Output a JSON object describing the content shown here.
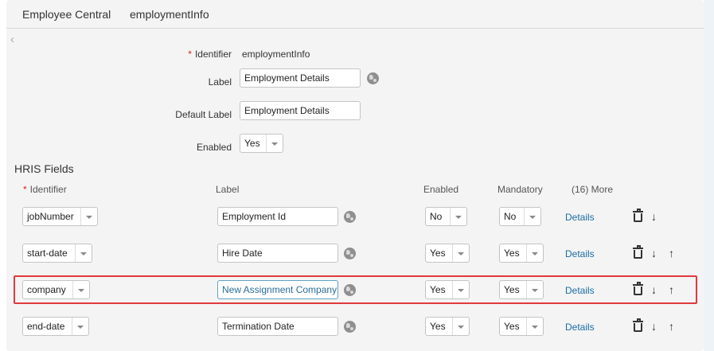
{
  "header": {
    "app": "Employee Central",
    "entity": "employmentInfo"
  },
  "form": {
    "identifier_label": "Identifier",
    "identifier_value": "employmentInfo",
    "label_label": "Label",
    "label_value": "Employment Details",
    "default_label_label": "Default Label",
    "default_label_value": "Employment Details",
    "enabled_label": "Enabled",
    "enabled_value": "Yes"
  },
  "hris": {
    "title": "HRIS Fields",
    "columns": {
      "identifier": "Identifier",
      "label": "Label",
      "enabled": "Enabled",
      "mandatory": "Mandatory",
      "more": "(16) More"
    },
    "rows": [
      {
        "identifier": "jobNumber",
        "label": "Employment Id",
        "enabled": "No",
        "mandatory": "No",
        "details": "Details"
      },
      {
        "identifier": "start-date",
        "label": "Hire Date",
        "enabled": "Yes",
        "mandatory": "Yes",
        "details": "Details"
      },
      {
        "identifier": "company",
        "label": "New Assignment Company",
        "enabled": "Yes",
        "mandatory": "Yes",
        "details": "Details"
      },
      {
        "identifier": "end-date",
        "label": "Termination Date",
        "enabled": "Yes",
        "mandatory": "Yes",
        "details": "Details"
      }
    ]
  },
  "icons": {
    "translate": "globe-icon",
    "delete": "trash-icon",
    "down": "arrow-down-icon",
    "up": "arrow-up-icon",
    "back": "chevron-left-icon"
  },
  "colors": {
    "link": "#1b6da3",
    "required": "#d0271d",
    "highlight": "#e0393e"
  }
}
